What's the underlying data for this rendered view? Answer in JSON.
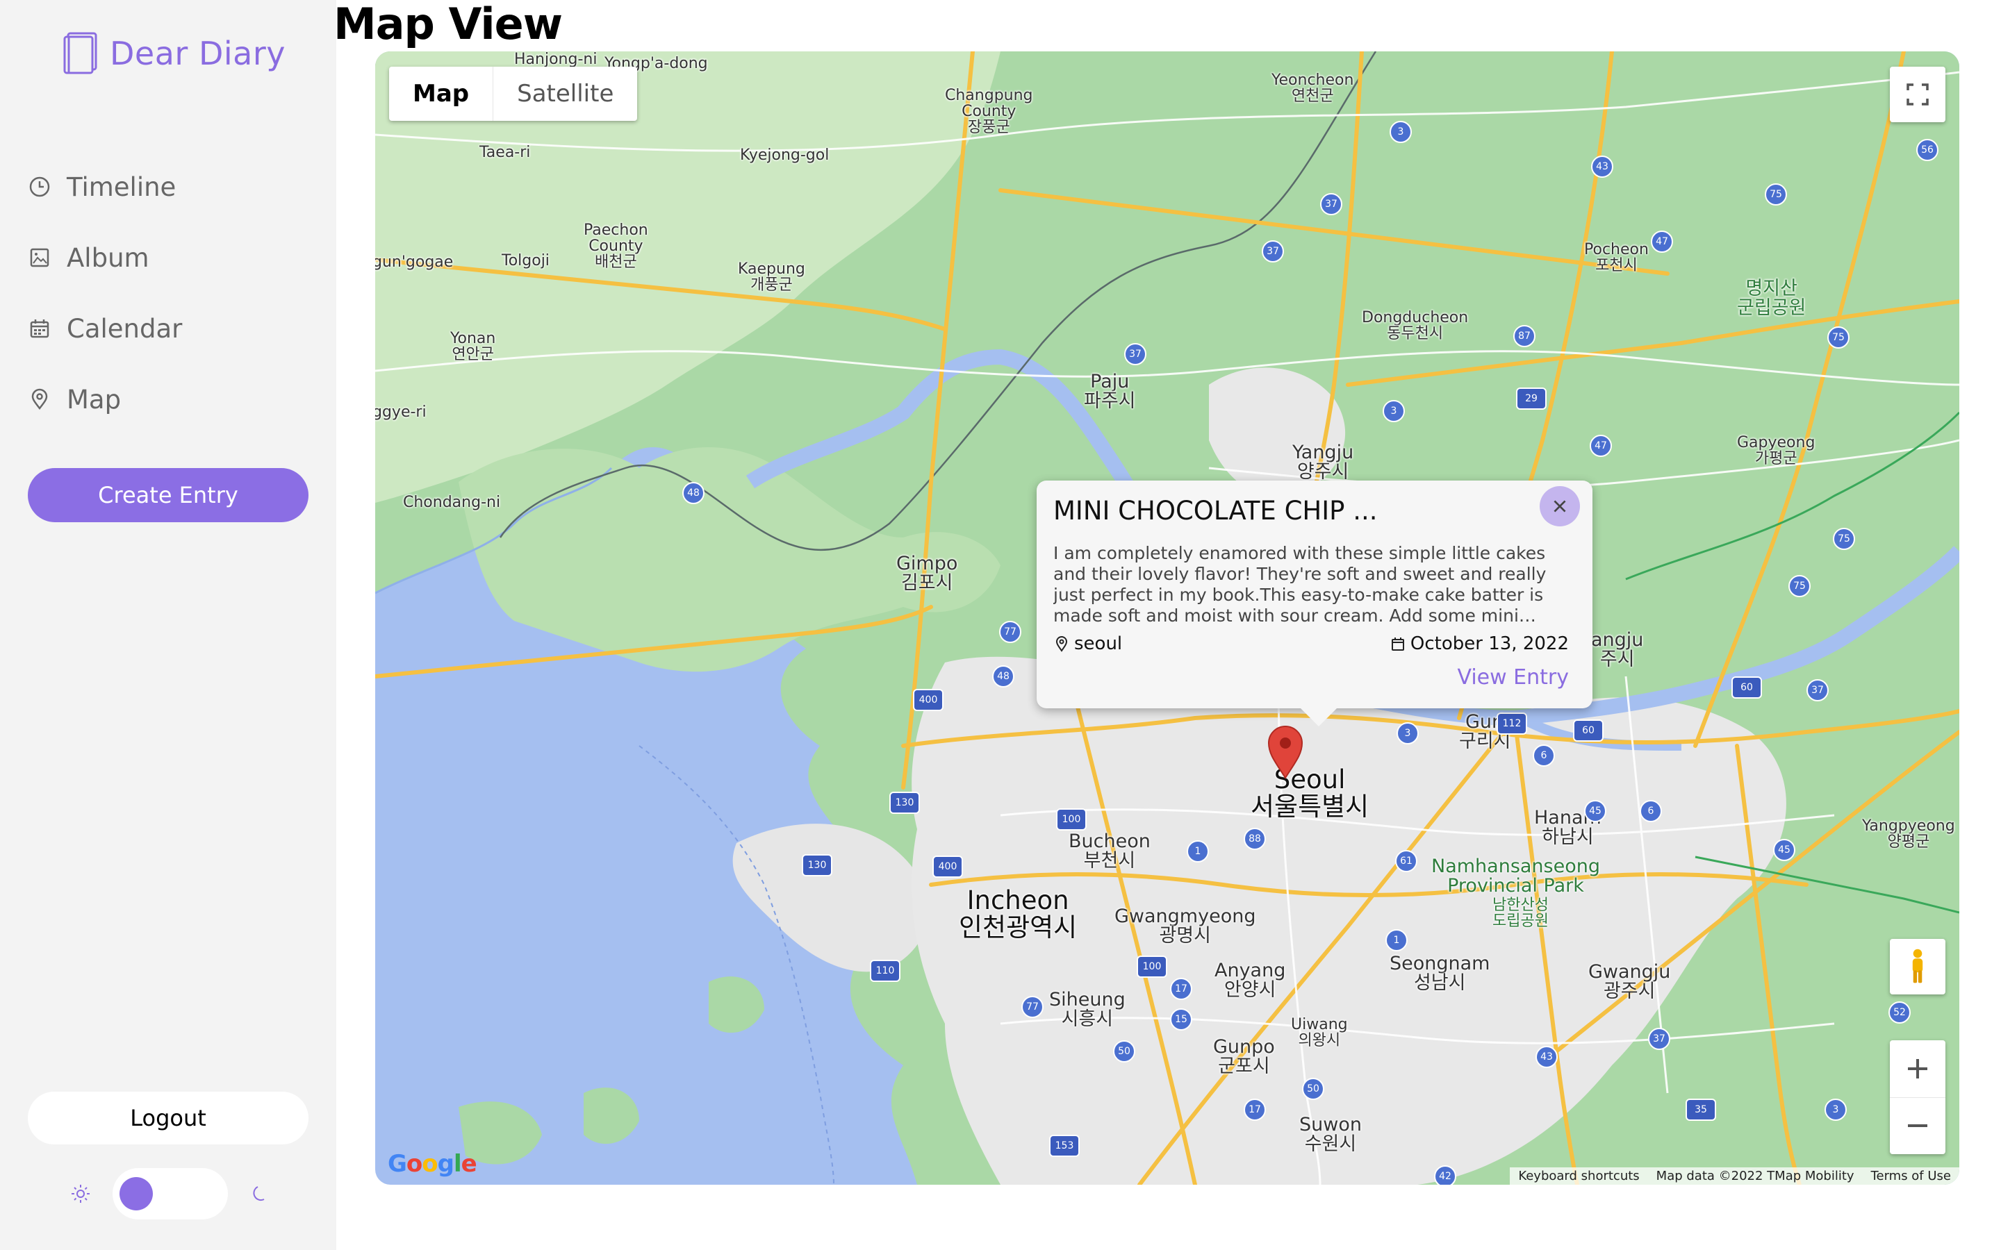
{
  "sidebar": {
    "brand": "Dear Diary",
    "nav": [
      {
        "label": "Timeline",
        "icon": "clock-icon"
      },
      {
        "label": "Album",
        "icon": "image-icon"
      },
      {
        "label": "Calendar",
        "icon": "calendar-icon"
      },
      {
        "label": "Map",
        "icon": "pin-icon"
      }
    ],
    "create_label": "Create Entry",
    "logout_label": "Logout",
    "theme": {
      "light_icon": "sun-icon",
      "dark_icon": "moon-icon",
      "mode": "light"
    }
  },
  "page_title": "Map View",
  "map": {
    "type_options": [
      "Map",
      "Satellite"
    ],
    "selected_type": "Map",
    "attribution": [
      "Keyboard shortcuts",
      "Map data ©2022 TMap Mobility",
      "Terms of Use"
    ],
    "logo": "Google",
    "places": {
      "hanjong": "Hanjong-ni",
      "yongpa": "Yongp'a-dong",
      "changpung": "Changpung\nCounty\n장풍군",
      "yeoncheon": "Yeoncheon\n연천군",
      "taea": "Taea-ri",
      "kyejong": "Kyejong-gol",
      "paechon": "Paechon\nCounty\n배천군",
      "gungogae": "gun'gogae",
      "tolgoji": "Tolgoji",
      "kaepung": "Kaepung\n개풍군",
      "pocheon": "Pocheon\n포천시",
      "dongducheon": "Dongducheon\n동두천시",
      "park_kr": "명지산\n군립공원",
      "yonan": "Yonan\n연안군",
      "paju": "Paju\n파주시",
      "gyyeri": "ggye-ri",
      "yangju": "Yangju\n양주시",
      "gapyeong": "Gapyeong\n가평군",
      "chondang": "Chondang-ni",
      "gimpo": "Gimpo\n김포시",
      "namyangju": "angju\n주시",
      "guri": "Guri\n구리시",
      "seoul": "Seoul\n서울특별시",
      "hanam": "Hanam\n하남시",
      "yangpyeong": "Yangpyeong\n양평군",
      "bucheon": "Bucheon\n부천시",
      "namhansan": "Namhansanseong\nProvincial Park",
      "namhansan_kr": "남한산성\n도립공원",
      "incheon": "Incheon\n인천광역시",
      "gwangmyeong": "Gwangmyeong\n광명시",
      "anyang": "Anyang\n안양시",
      "seongnam": "Seongnam\n성남시",
      "gwangju": "Gwangju\n광주시",
      "siheung": "Siheung\n시흥시",
      "uiwang": "Uiwang\n의왕시",
      "gunpo": "Gunpo\n군포시",
      "suwon": "Suwon\n수원시"
    },
    "shields": [
      "3",
      "56",
      "43",
      "75",
      "37",
      "47",
      "37",
      "37",
      "87",
      "75",
      "29",
      "3",
      "47",
      "48",
      "75",
      "75",
      "77",
      "48",
      "400",
      "60",
      "37",
      "3",
      "112",
      "60",
      "6",
      "45",
      "6",
      "45",
      "100",
      "1",
      "88",
      "61",
      "130",
      "130",
      "400",
      "1",
      "110",
      "100",
      "17",
      "77",
      "15",
      "50",
      "37",
      "43",
      "52",
      "50",
      "17",
      "153",
      "35",
      "3",
      "42"
    ]
  },
  "popup": {
    "title": "MINI CHOCOLATE CHIP ...",
    "body": "I am completely enamored with these simple little cakes and their lovely flavor! They're soft and sweet and really just perfect in my book.This easy-to-make cake batter is made soft and moist with sour cream. Add some mini chocolate chips to...",
    "location": "seoul",
    "date": "October 13, 2022",
    "view_label": "View Entry"
  },
  "colors": {
    "accent": "#8b6ee4",
    "sidebar_bg": "#f3f3f3",
    "water": "#a5bff0",
    "land": "#a8d8a8",
    "urban": "#e8e8e8",
    "marker": "#e0443a"
  }
}
